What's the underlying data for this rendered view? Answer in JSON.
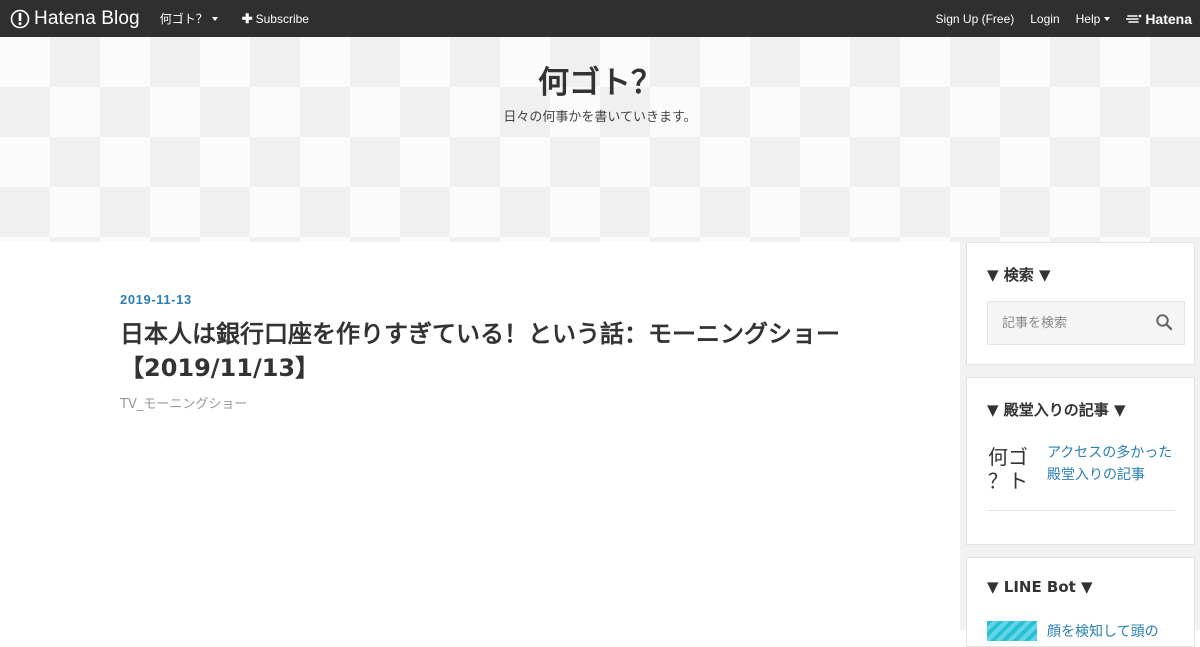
{
  "globalbar": {
    "brand": "Hatena Blog",
    "blog_menu": "何ゴト？",
    "subscribe": "Subscribe",
    "signup": "Sign Up (Free)",
    "login": "Login",
    "help": "Help",
    "hatena": "Hatena",
    "colors": {
      "bar_bg": "#2f2f2f",
      "text": "#ffffff"
    }
  },
  "header": {
    "title": "何ゴト？",
    "description": "日々の何事かを書いていきます。"
  },
  "entry": {
    "date": "2019-11-13",
    "title": "日本人は銀行口座を作りすぎている！という話：モーニングショー【2019/11/13】",
    "category": "TV_モーニングショー",
    "colors": {
      "date": "#2a7fb3"
    }
  },
  "sidebar": {
    "search": {
      "title": "▼ 検索 ▼",
      "placeholder": "記事を検索",
      "icon": "search-icon"
    },
    "hall_of_fame": {
      "title": "▼ 殿堂入りの記事 ▼",
      "thumb_text": "何ゴ\n？ト",
      "link": "アクセスの多かった殿堂入りの記事"
    },
    "line_bot": {
      "title": "▼ LINE Bot ▼",
      "link": "顔を検知して頭の"
    },
    "colors": {
      "link": "#2a7fb3",
      "bg": "#f2f2f2"
    }
  }
}
